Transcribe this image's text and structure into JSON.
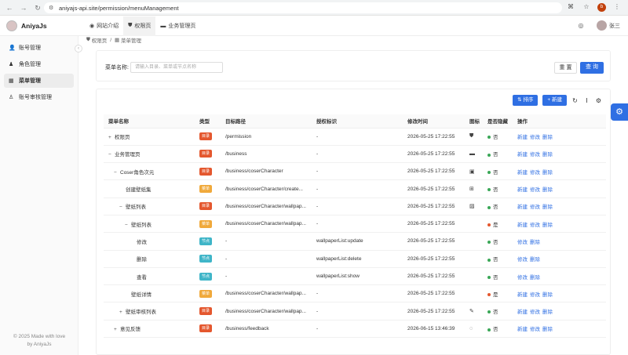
{
  "browser": {
    "url": "aniyajs-api.site/permission/menuManagement",
    "profile_letter": "b"
  },
  "app": {
    "logo_text": "AniyaJs",
    "top_tabs": [
      {
        "label": "网站介绍",
        "icon": "dashboard-icon"
      },
      {
        "label": "权限页",
        "icon": "shield-icon",
        "active": true
      },
      {
        "label": "业务管理页",
        "icon": "briefcase-icon"
      }
    ],
    "username": "张三"
  },
  "sidebar": {
    "items": [
      {
        "label": "账号管理",
        "icon": "user-icon"
      },
      {
        "label": "角色管理",
        "icon": "role-icon"
      },
      {
        "label": "菜单管理",
        "icon": "menu-icon",
        "active": true
      },
      {
        "label": "账号审核管理",
        "icon": "audit-icon"
      }
    ],
    "footer_line1": "© 2025 Made with love",
    "footer_line2": "by AniyaJs"
  },
  "breadcrumb": {
    "parent": "权限页",
    "current": "菜单管理"
  },
  "search": {
    "label": "菜单名称:",
    "placeholder": "请输入目录、菜单或节点名称",
    "reset_label": "重 置",
    "query_label": "查 询"
  },
  "toolbar": {
    "sort_label": "排序",
    "new_label": "新建"
  },
  "table": {
    "headers": [
      "菜单名称",
      "类型",
      "目标路径",
      "授权标识",
      "修改时间",
      "图标",
      "是否隐藏",
      "操作"
    ],
    "type_colors": {
      "目录": "#e4572e",
      "菜单": "#f0a93b",
      "节点": "#3fb5c8"
    },
    "hidden_colors": {
      "否": "#3aa757",
      "是": "#e4572e"
    },
    "rows": [
      {
        "expander": "+",
        "indent": 0,
        "name": "权限页",
        "type": "目录",
        "path": "/permission",
        "perm": "-",
        "time": "2026-05-25 17:22:55",
        "icon": "⛊",
        "hidden": "否",
        "ops": [
          "新建",
          "修改",
          "删除"
        ]
      },
      {
        "expander": "−",
        "indent": 0,
        "name": "业务管理页",
        "type": "目录",
        "path": "/business",
        "perm": "-",
        "time": "2026-05-25 17:22:55",
        "icon": "▬",
        "hidden": "否",
        "ops": [
          "新建",
          "修改",
          "删除"
        ]
      },
      {
        "expander": "−",
        "indent": 1,
        "name": "Coser角色次元",
        "type": "目录",
        "path": "/business/coserCharacter",
        "perm": "-",
        "time": "2026-05-25 17:22:55",
        "icon": "▣",
        "hidden": "否",
        "ops": [
          "新建",
          "修改",
          "删除"
        ]
      },
      {
        "expander": "",
        "indent": 2,
        "name": "创建壁纸集",
        "type": "菜单",
        "path": "/business/coserCharacter/create...",
        "perm": "-",
        "time": "2026-05-25 17:22:55",
        "icon": "⊞",
        "hidden": "否",
        "ops": [
          "新建",
          "修改",
          "删除"
        ]
      },
      {
        "expander": "−",
        "indent": 2,
        "name": "壁纸列表",
        "type": "目录",
        "path": "/business/coserCharacter/wallpap...",
        "perm": "-",
        "time": "2026-05-25 17:22:55",
        "icon": "▨",
        "hidden": "否",
        "ops": [
          "新建",
          "修改",
          "删除"
        ]
      },
      {
        "expander": "−",
        "indent": 3,
        "name": "壁纸列表",
        "type": "菜单",
        "path": "/business/coserCharacter/wallpap...",
        "perm": "-",
        "time": "2026-05-25 17:22:55",
        "icon": "",
        "hidden": "是",
        "ops": [
          "新建",
          "修改",
          "删除"
        ]
      },
      {
        "expander": "",
        "indent": 4,
        "name": "修改",
        "type": "节点",
        "path": "-",
        "perm": "wallpaperList:update",
        "time": "2026-05-25 17:22:55",
        "icon": "",
        "hidden": "否",
        "ops": [
          "修改",
          "删除"
        ]
      },
      {
        "expander": "",
        "indent": 4,
        "name": "删除",
        "type": "节点",
        "path": "-",
        "perm": "wallpaperList:delete",
        "time": "2026-05-25 17:22:55",
        "icon": "",
        "hidden": "否",
        "ops": [
          "修改",
          "删除"
        ]
      },
      {
        "expander": "",
        "indent": 4,
        "name": "查看",
        "type": "节点",
        "path": "-",
        "perm": "wallpaperList:show",
        "time": "2026-05-25 17:22:55",
        "icon": "",
        "hidden": "否",
        "ops": [
          "修改",
          "删除"
        ]
      },
      {
        "expander": "",
        "indent": 3,
        "name": "壁纸详情",
        "type": "菜单",
        "path": "/business/coserCharacter/wallpap...",
        "perm": "-",
        "time": "2026-05-25 17:22:55",
        "icon": "",
        "hidden": "是",
        "ops": [
          "新建",
          "修改",
          "删除"
        ]
      },
      {
        "expander": "+",
        "indent": 2,
        "name": "壁纸审核列表",
        "type": "目录",
        "path": "/business/coserCharacter/wallpap...",
        "perm": "-",
        "time": "2026-05-25 17:22:55",
        "icon": "✎",
        "hidden": "否",
        "ops": [
          "新建",
          "修改",
          "删除"
        ]
      },
      {
        "expander": "+",
        "indent": 1,
        "name": "意见反馈",
        "type": "目录",
        "path": "/business/feedback",
        "perm": "-",
        "time": "2026-06-15 13:46:39",
        "icon": "◌",
        "hidden": "否",
        "ops": [
          "新建",
          "修改",
          "删除"
        ]
      }
    ]
  }
}
